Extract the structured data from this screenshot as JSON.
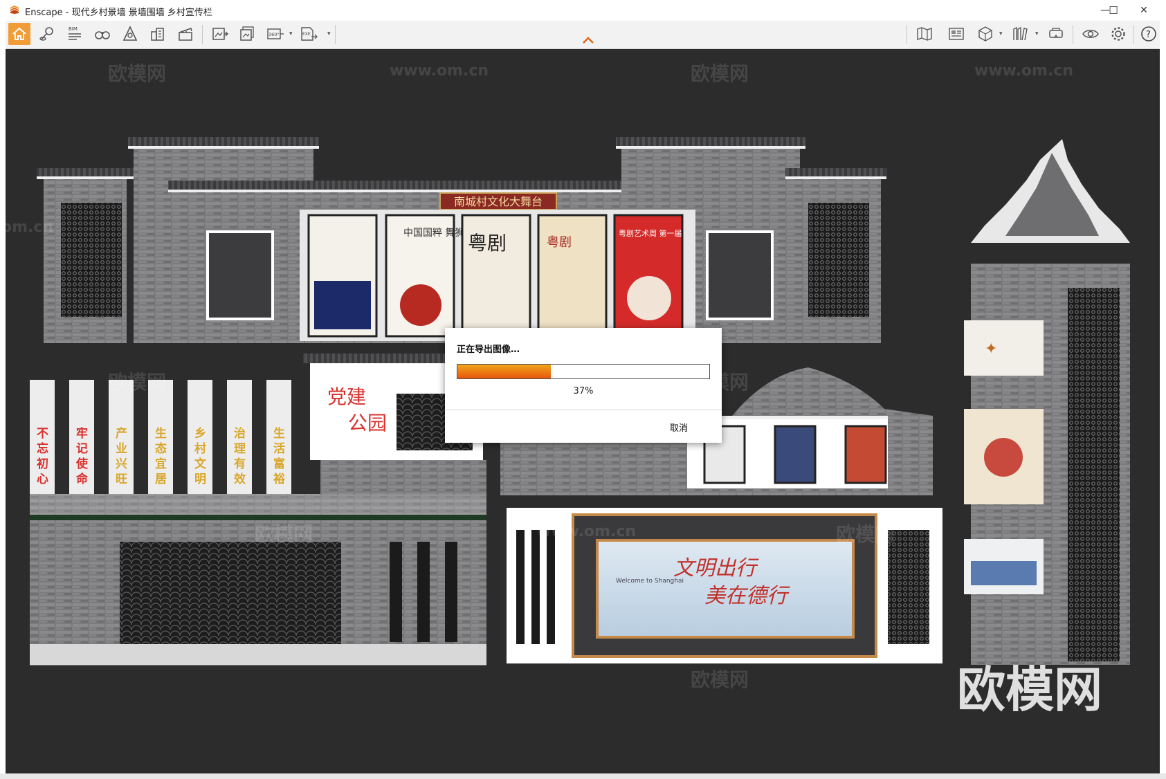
{
  "window": {
    "app_name": "Enscape",
    "title_sep": " - ",
    "document_title": "现代乡村景墙 景墙围墙 乡村宣传栏",
    "minimize_glyph": "—",
    "maximize_glyph": "☐",
    "close_glyph": "✕"
  },
  "toolbar": {
    "bim_label": "BIM",
    "pano_label": "360°",
    "exe_label": "EXE",
    "left_icons": [
      "home-icon",
      "location-pin-icon",
      "bim-icon",
      "binoculars-icon",
      "perspective-icon",
      "buildings-icon",
      "clapper-icon",
      "screenshot-icon",
      "batch-render-icon",
      "panorama-icon",
      "exe-export-icon"
    ],
    "right_icons": [
      "map-icon",
      "view-management-icon",
      "box-icon",
      "asset-library-icon",
      "vr-headset-icon",
      "visibility-icon",
      "settings-icon",
      "help-icon"
    ],
    "collapse_icon": "chevron-up-icon",
    "accent": "#f29c38"
  },
  "scene": {
    "stage_sign": "南城村文化大舞台",
    "party_park_line1": "党建",
    "party_park_line2": "公园",
    "pillars": [
      "不忘初心",
      "牢记使命",
      "产业兴旺",
      "生态宜居",
      "乡村文明",
      "治理有效",
      "生活富裕"
    ],
    "posters": [
      "中国国粹 舞狮",
      "粤剧",
      "粤剧",
      "粤剧艺术周 第一届"
    ],
    "slogan_line1": "文明出行",
    "slogan_line2": "美在德行",
    "slogan_sub": "Welcome to Shanghai",
    "watermark_cn": "欧模网",
    "watermark_url": "www.om.cn",
    "watermark_om": "om.cn",
    "watermark_big": "欧模网"
  },
  "export_dialog": {
    "title": "正在导出图像…",
    "progress_fraction": 0.37,
    "progress_label": "37%",
    "cancel_label": "取消"
  },
  "colors": {
    "viewport_bg": "#2c2c2d",
    "progress_start": "#f0a51a",
    "progress_end": "#e8560f",
    "pillar_red": "#d9302c",
    "pillar_gold": "#d9a62a"
  }
}
